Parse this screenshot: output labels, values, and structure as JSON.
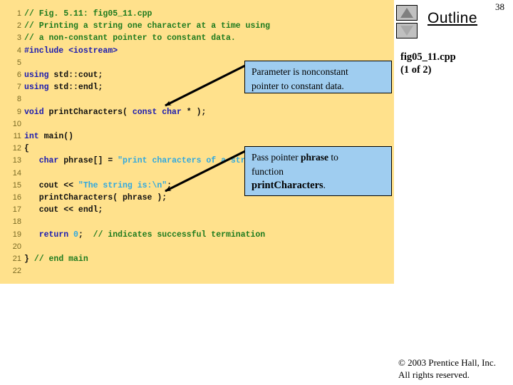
{
  "slide": {
    "page_number": "38",
    "outline_title": "Outline",
    "file_label": "fig05_11.cpp",
    "file_sublabel": "(1 of 2)",
    "nav_up_icon": "triangle-up-icon",
    "nav_down_icon": "triangle-down-icon",
    "footer_line1": "© 2003 Prentice Hall, Inc.",
    "footer_line2": "All rights reserved."
  },
  "colors": {
    "code_background": "#ffe18c",
    "comment": "#1d7a1d",
    "keyword": "#1a1ab0",
    "string": "#2fa8e0",
    "plain": "#101010",
    "line_number": "#7a6a24",
    "callout_fill": "#9fcdf0",
    "callout_border": "#000000",
    "nav_button_face": "#c0c0c0"
  },
  "code": {
    "lines": [
      {
        "n": "1",
        "segments": [
          {
            "t": "// Fig. 5.11: fig05_11.cpp",
            "c": "c-comment"
          }
        ]
      },
      {
        "n": "2",
        "segments": [
          {
            "t": "// Printing a string one character at a time using",
            "c": "c-comment"
          }
        ]
      },
      {
        "n": "3",
        "segments": [
          {
            "t": "// a non-constant pointer to constant data.",
            "c": "c-comment"
          }
        ]
      },
      {
        "n": "4",
        "segments": [
          {
            "t": "#include <iostream>",
            "c": "c-kw"
          }
        ]
      },
      {
        "n": "5",
        "segments": [
          {
            "t": "",
            "c": "c-plain"
          }
        ]
      },
      {
        "n": "6",
        "segments": [
          {
            "t": "using",
            "c": "c-kw"
          },
          {
            "t": " std::cout;",
            "c": "c-plain"
          }
        ]
      },
      {
        "n": "7",
        "segments": [
          {
            "t": "using",
            "c": "c-kw"
          },
          {
            "t": " std::endl;",
            "c": "c-plain"
          }
        ]
      },
      {
        "n": "8",
        "segments": [
          {
            "t": "",
            "c": "c-plain"
          }
        ]
      },
      {
        "n": "9",
        "segments": [
          {
            "t": "void",
            "c": "c-kw"
          },
          {
            "t": " printCharacters( ",
            "c": "c-plain"
          },
          {
            "t": "const char",
            "c": "c-kw"
          },
          {
            "t": " * );",
            "c": "c-plain"
          }
        ]
      },
      {
        "n": "10",
        "segments": [
          {
            "t": "",
            "c": "c-plain"
          }
        ]
      },
      {
        "n": "11",
        "segments": [
          {
            "t": "int",
            "c": "c-kw"
          },
          {
            "t": " main()",
            "c": "c-plain"
          }
        ]
      },
      {
        "n": "12",
        "segments": [
          {
            "t": "{",
            "c": "c-plain"
          }
        ]
      },
      {
        "n": "13",
        "segments": [
          {
            "t": "   ",
            "c": "c-plain"
          },
          {
            "t": "char",
            "c": "c-kw"
          },
          {
            "t": " phrase[] = ",
            "c": "c-plain"
          },
          {
            "t": "\"print characters of a string\"",
            "c": "c-str"
          },
          {
            "t": ";",
            "c": "c-plain"
          }
        ]
      },
      {
        "n": "14",
        "segments": [
          {
            "t": "",
            "c": "c-plain"
          }
        ]
      },
      {
        "n": "15",
        "segments": [
          {
            "t": "   cout << ",
            "c": "c-plain"
          },
          {
            "t": "\"The string is:\\n\"",
            "c": "c-str"
          },
          {
            "t": ";",
            "c": "c-plain"
          }
        ]
      },
      {
        "n": "16",
        "segments": [
          {
            "t": "   printCharacters( phrase );",
            "c": "c-plain"
          }
        ]
      },
      {
        "n": "17",
        "segments": [
          {
            "t": "   cout << endl;",
            "c": "c-plain"
          }
        ]
      },
      {
        "n": "18",
        "segments": [
          {
            "t": "",
            "c": "c-plain"
          }
        ]
      },
      {
        "n": "19",
        "segments": [
          {
            "t": "   ",
            "c": "c-plain"
          },
          {
            "t": "return",
            "c": "c-kw"
          },
          {
            "t": " ",
            "c": "c-plain"
          },
          {
            "t": "0",
            "c": "c-num"
          },
          {
            "t": ";  ",
            "c": "c-plain"
          },
          {
            "t": "// indicates successful termination",
            "c": "c-comment"
          }
        ]
      },
      {
        "n": "20",
        "segments": [
          {
            "t": "",
            "c": "c-plain"
          }
        ]
      },
      {
        "n": "21",
        "segments": [
          {
            "t": "} ",
            "c": "c-plain"
          },
          {
            "t": "// end main",
            "c": "c-comment"
          }
        ]
      },
      {
        "n": "22",
        "segments": [
          {
            "t": "",
            "c": "c-plain"
          }
        ]
      }
    ]
  },
  "callouts": [
    {
      "id": "callout-parameter",
      "lines": [
        [
          {
            "t": "Parameter is nonconstant",
            "style": "normal"
          }
        ],
        [
          {
            "t": "pointer to constant data.",
            "style": "normal"
          }
        ]
      ]
    },
    {
      "id": "callout-pass-pointer",
      "lines": [
        [
          {
            "t": "Pass pointer ",
            "style": "normal"
          },
          {
            "t": "phrase",
            "style": "mono"
          },
          {
            "t": " to",
            "style": "normal"
          }
        ],
        [
          {
            "t": "function",
            "style": "normal"
          }
        ],
        [
          {
            "t": "printCharacters",
            "style": "big"
          },
          {
            "t": ".",
            "style": "normal"
          }
        ]
      ]
    }
  ]
}
